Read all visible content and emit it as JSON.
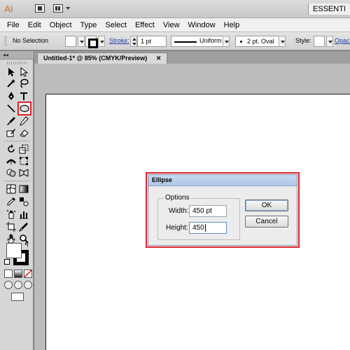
{
  "app": {
    "logo": "Ai",
    "workspace": "ESSENTI"
  },
  "menu": [
    "File",
    "Edit",
    "Object",
    "Type",
    "Select",
    "Effect",
    "View",
    "Window",
    "Help"
  ],
  "control_bar": {
    "selection": "No Selection",
    "stroke_label": "Stroke:",
    "stroke_weight": "1 pt",
    "profile": "Uniform",
    "brush": "2 pt. Oval",
    "style_label": "Style:",
    "opacity_label": "Opacity"
  },
  "document": {
    "tab_title": "Untitled-1* @ 85% (CMYK/Preview)",
    "close": "✕"
  },
  "tools": {
    "highlighted": "ellipse-tool",
    "highlight_color": "#e0202c"
  },
  "dialog": {
    "title": "Ellipse",
    "group_label": "Options",
    "width_label": "Width:",
    "width_value": "450 pt",
    "height_label": "Height:",
    "height_value": "450",
    "ok_label": "OK",
    "cancel_label": "Cancel",
    "highlight_color": "#d9212c"
  }
}
